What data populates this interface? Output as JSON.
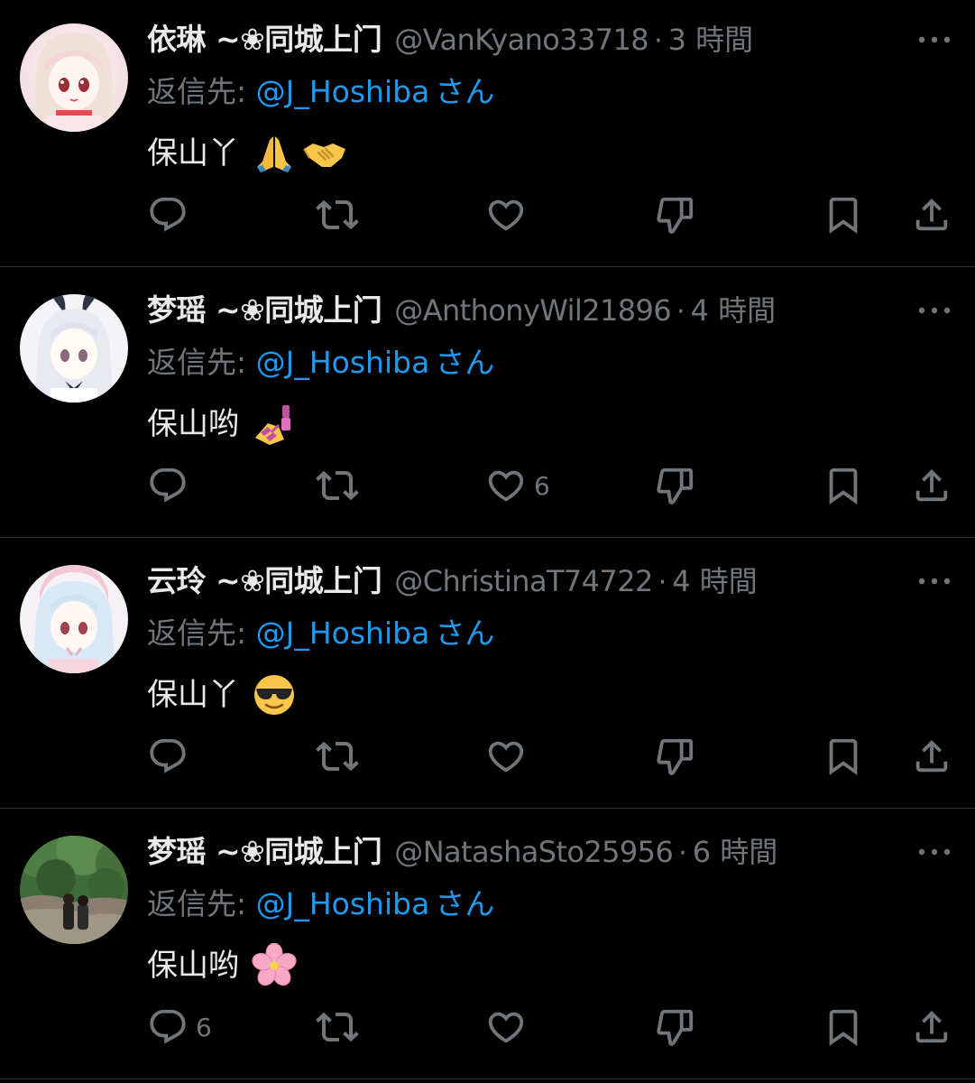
{
  "colors": {
    "background": "#000000",
    "text_primary": "#e7e9ea",
    "text_secondary": "#71767b",
    "link": "#1d9bf0",
    "divider": "#2f3336"
  },
  "reply_label": "返信先:",
  "reply_suffix": "さん",
  "tweets": [
    {
      "name": "依琳 ~❀同城上门",
      "handle": "@VanKyano33718",
      "separator": "·",
      "time": "3 時間",
      "mention": "@J_Hoshiba",
      "text": "保山丫",
      "emojis": [
        "folded-hands-emoji",
        "handshake-emoji"
      ],
      "avatar": "anime-girl-pink-avatar",
      "counts": {
        "reply": "",
        "retweet": "",
        "like": "",
        "dislike": "",
        "bookmark": "",
        "share": ""
      }
    },
    {
      "name": "梦瑶 ~❀同城上门",
      "handle": "@AnthonyWil21896",
      "separator": "·",
      "time": "4 時間",
      "mention": "@J_Hoshiba",
      "text": "保山哟",
      "emojis": [
        "nail-polish-emoji"
      ],
      "avatar": "anime-girl-white-avatar",
      "counts": {
        "reply": "",
        "retweet": "",
        "like": "6",
        "dislike": "",
        "bookmark": "",
        "share": ""
      }
    },
    {
      "name": "云玲 ~❀同城上门",
      "handle": "@ChristinaT74722",
      "separator": "·",
      "time": "4 時間",
      "mention": "@J_Hoshiba",
      "text": "保山丫",
      "emojis": [
        "sunglasses-face-emoji"
      ],
      "avatar": "anime-girl-bunny-avatar",
      "counts": {
        "reply": "",
        "retweet": "",
        "like": "",
        "dislike": "",
        "bookmark": "",
        "share": ""
      }
    },
    {
      "name": "梦瑶 ~❀同城上门",
      "handle": "@NatashaSto25956",
      "separator": "·",
      "time": "6 時間",
      "mention": "@J_Hoshiba",
      "text": "保山哟",
      "emojis": [
        "cherry-blossom-emoji"
      ],
      "avatar": "outdoor-photo-avatar",
      "counts": {
        "reply": "6",
        "retweet": "",
        "like": "",
        "dislike": "",
        "bookmark": "",
        "share": ""
      }
    }
  ],
  "action_icons": [
    "reply-icon",
    "retweet-icon",
    "like-icon",
    "dislike-icon",
    "bookmark-icon",
    "share-icon"
  ]
}
